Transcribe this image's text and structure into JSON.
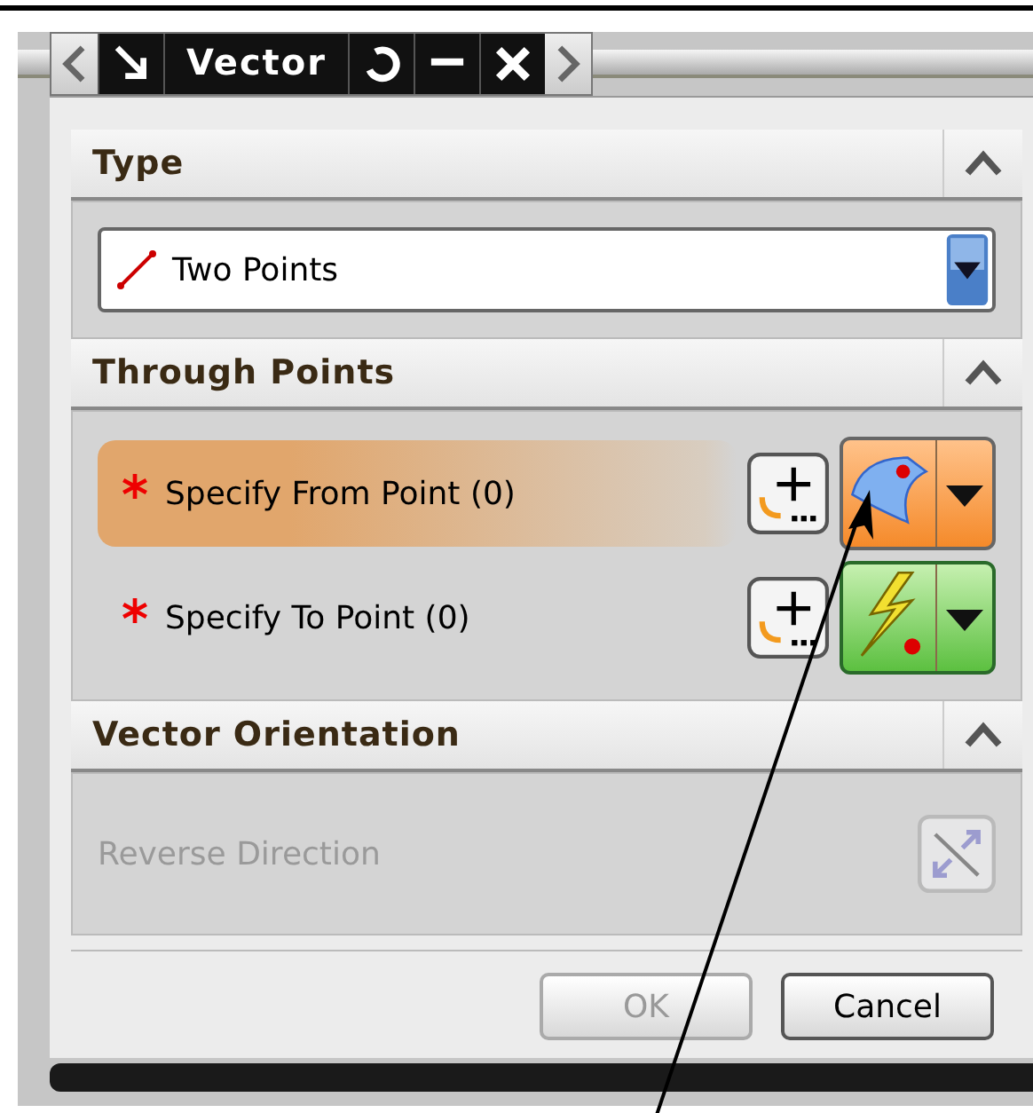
{
  "window": {
    "title": "Vector"
  },
  "sections": [
    {
      "kind": "type",
      "title": "Type",
      "expanded": true,
      "dropdown": {
        "value": "Two Points"
      }
    },
    {
      "kind": "points",
      "title": "Through Points",
      "expanded": true,
      "rows": [
        {
          "label": "Specify From Point (0)",
          "required": true,
          "selected": true
        },
        {
          "label": "Specify To Point (0)",
          "required": true,
          "selected": false
        }
      ]
    },
    {
      "kind": "orientation",
      "title": "Vector Orientation",
      "expanded": true,
      "option": {
        "label": "Reverse Direction",
        "disabled": true
      }
    }
  ],
  "buttons": [
    {
      "label": "OK",
      "disabled": true
    },
    {
      "label": "Cancel",
      "disabled": false
    }
  ]
}
